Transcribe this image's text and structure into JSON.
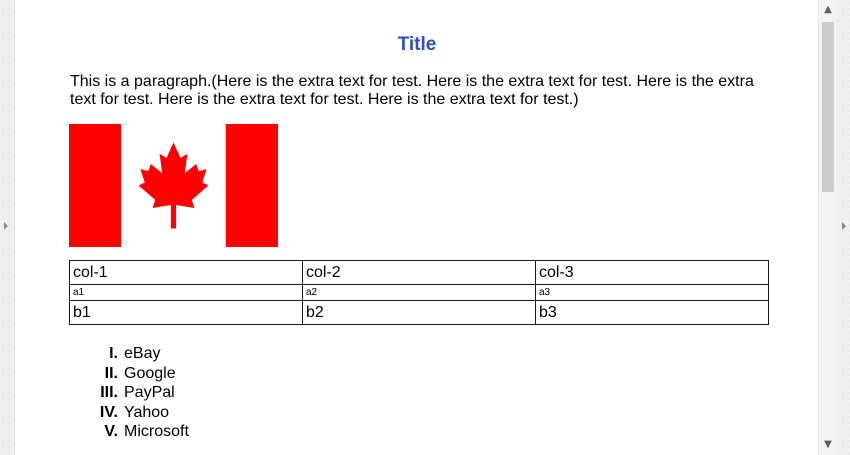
{
  "page": {
    "title": "Title",
    "paragraph": "This is a paragraph.(Here is the extra text for test. Here is the extra text for test. Here is the extra text for test. Here is the extra text for test. Here is the extra text for test.)"
  },
  "flag": {
    "icon": "canada-flag",
    "colors": {
      "red": "#ff0000",
      "white": "#ffffff"
    }
  },
  "table": {
    "rows": [
      [
        "col-1",
        "col-2",
        "col-3"
      ],
      [
        "a1",
        "a2",
        "a3"
      ],
      [
        "b1",
        "b2",
        "b3"
      ]
    ]
  },
  "list": {
    "items": [
      {
        "numeral": "I.",
        "label": "eBay"
      },
      {
        "numeral": "II.",
        "label": "Google"
      },
      {
        "numeral": "III.",
        "label": "PayPal"
      },
      {
        "numeral": "IV.",
        "label": "Yahoo"
      },
      {
        "numeral": "V.",
        "label": "Microsoft"
      }
    ]
  },
  "scrollbar": {
    "up_icon": "▲",
    "down_icon": "▼"
  },
  "colors": {
    "title": "#2e4ec9",
    "border": "#1a1a1a"
  }
}
